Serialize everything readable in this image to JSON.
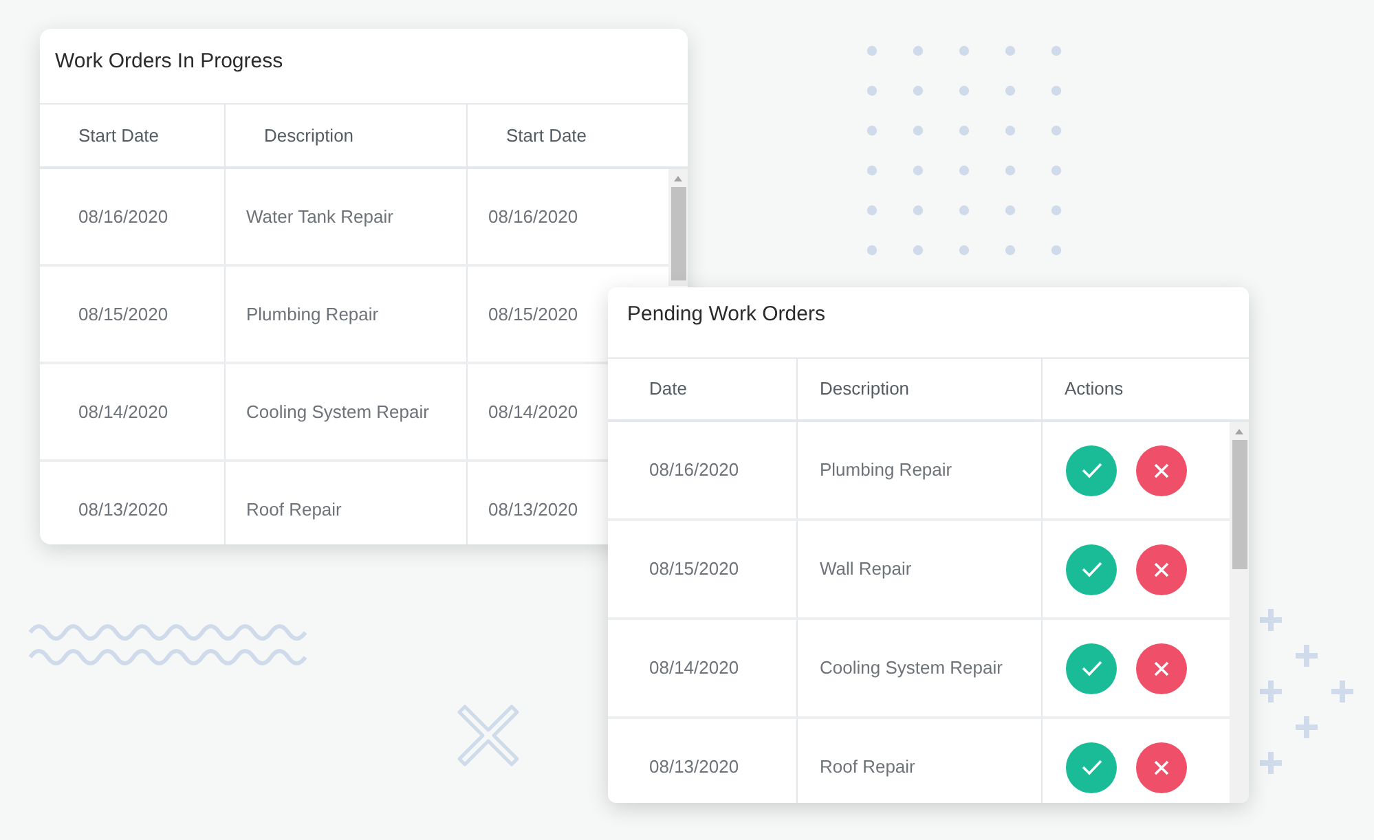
{
  "work_orders_in_progress": {
    "title": "Work Orders In Progress",
    "columns": [
      "Start Date",
      "Description",
      "Start Date"
    ],
    "rows": [
      {
        "cells": [
          "08/16/2020",
          "Water Tank Repair",
          "08/16/2020"
        ]
      },
      {
        "cells": [
          "08/15/2020",
          "Plumbing Repair",
          "08/15/2020"
        ]
      },
      {
        "cells": [
          "08/14/2020",
          "Cooling System Repair",
          "08/14/2020"
        ]
      },
      {
        "cells": [
          "08/13/2020",
          "Roof Repair",
          "08/13/2020"
        ]
      }
    ]
  },
  "pending_work_orders": {
    "title": "Pending Work Orders",
    "columns": [
      "Date",
      "Description",
      "Actions"
    ],
    "rows": [
      {
        "cells": [
          "08/16/2020",
          "Plumbing Repair"
        ]
      },
      {
        "cells": [
          "08/15/2020",
          "Wall Repair"
        ]
      },
      {
        "cells": [
          "08/14/2020",
          "Cooling System Repair"
        ]
      },
      {
        "cells": [
          "08/13/2020",
          "Roof Repair"
        ]
      }
    ]
  }
}
